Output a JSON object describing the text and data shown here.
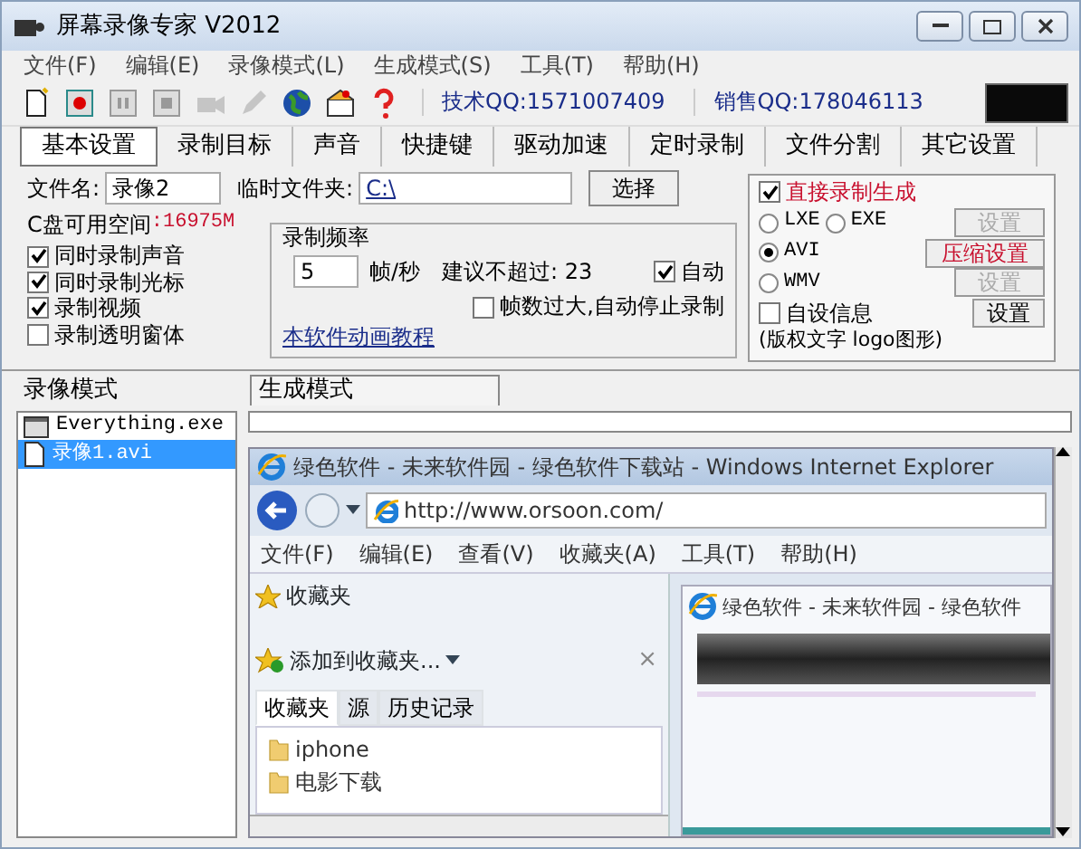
{
  "window": {
    "title": "屏幕录像专家 V2012"
  },
  "menu": [
    "文件(F)",
    "编辑(E)",
    "录像模式(L)",
    "生成模式(S)",
    "工具(T)",
    "帮助(H)"
  ],
  "toolbar": {
    "tools": [
      {
        "kind": "new",
        "disabled": false
      },
      {
        "kind": "record",
        "disabled": false
      },
      {
        "kind": "pause",
        "disabled": false
      },
      {
        "kind": "stop",
        "disabled": false
      },
      {
        "kind": "camera",
        "disabled": true
      },
      {
        "kind": "pen",
        "disabled": true
      },
      {
        "kind": "globe",
        "disabled": false
      },
      {
        "kind": "gift",
        "disabled": false
      },
      {
        "kind": "help",
        "disabled": false
      }
    ],
    "support": "技术QQ:1571007409",
    "sales": "销售QQ:178046113"
  },
  "tabs": [
    {
      "label": "基本设置",
      "selected": true
    },
    {
      "label": "录制目标",
      "selected": false
    },
    {
      "label": "声音",
      "selected": false
    },
    {
      "label": "快捷键",
      "selected": false
    },
    {
      "label": "驱动加速",
      "selected": false
    },
    {
      "label": "定时录制",
      "selected": false
    },
    {
      "label": "文件分割",
      "selected": false
    },
    {
      "label": "其它设置",
      "selected": false
    }
  ],
  "basic": {
    "filename_label": "文件名:",
    "filename": "录像2",
    "temp_label": "临时文件夹:",
    "temp": "C:\\",
    "choose": "选择",
    "disk_label": "C盘可用空间",
    "disk_value": ":16975M",
    "options": [
      {
        "label": "同时录制声音",
        "checked": true
      },
      {
        "label": "同时录制光标",
        "checked": true
      },
      {
        "label": "录制视频",
        "checked": true
      },
      {
        "label": "录制透明窗体",
        "checked": false
      }
    ],
    "rate": {
      "title": "录制频率",
      "value": "5",
      "unit": "帧/秒",
      "advice": "建议不超过: 23",
      "auto": {
        "label": "自动",
        "checked": true
      },
      "stop": {
        "label": "帧数过大,自动停止录制",
        "checked": false
      }
    },
    "link": "本软件动画教程"
  },
  "output": {
    "direct": {
      "label": "直接录制生成",
      "checked": true
    },
    "rows": [
      {
        "formats": [
          {
            "label": "LXE",
            "selected": false
          },
          {
            "label": "EXE",
            "selected": false
          }
        ],
        "button": {
          "label": "设置",
          "disabled": true,
          "highlight": false
        }
      },
      {
        "formats": [
          {
            "label": "AVI",
            "selected": true
          }
        ],
        "button": {
          "label": "压缩设置",
          "disabled": false,
          "highlight": true
        }
      },
      {
        "formats": [
          {
            "label": "WMV",
            "selected": false
          }
        ],
        "button": {
          "label": "设置",
          "disabled": true,
          "highlight": false
        }
      }
    ],
    "custom": {
      "label": "自设信息",
      "checked": false
    },
    "custom_button": "设置",
    "custom_note": "(版权文字 logo图形)"
  },
  "record_mode": "录像模式",
  "build_mode": "生成模式",
  "files": [
    {
      "name": "Everything.exe",
      "kind": "app",
      "selected": false
    },
    {
      "name": "录像1.avi",
      "kind": "file",
      "selected": true
    }
  ],
  "preview": {
    "title": "绿色软件 - 未来软件园 - 绿色软件下载站 - Windows Internet Explorer",
    "address": "http://www.orsoon.com/",
    "menu": [
      "文件(F)",
      "编辑(E)",
      "查看(V)",
      "收藏夹(A)",
      "工具(T)",
      "帮助(H)"
    ],
    "favorites": {
      "title": "收藏夹",
      "add": "添加到收藏夹...",
      "close": "×",
      "tabs": [
        {
          "label": "收藏夹",
          "selected": true
        },
        {
          "label": "源",
          "selected": false
        },
        {
          "label": "历史记录",
          "selected": false
        }
      ],
      "items": [
        "iphone",
        "电影下载"
      ]
    },
    "inner_title": "绿色软件 - 未来软件园 - 绿色软件"
  }
}
